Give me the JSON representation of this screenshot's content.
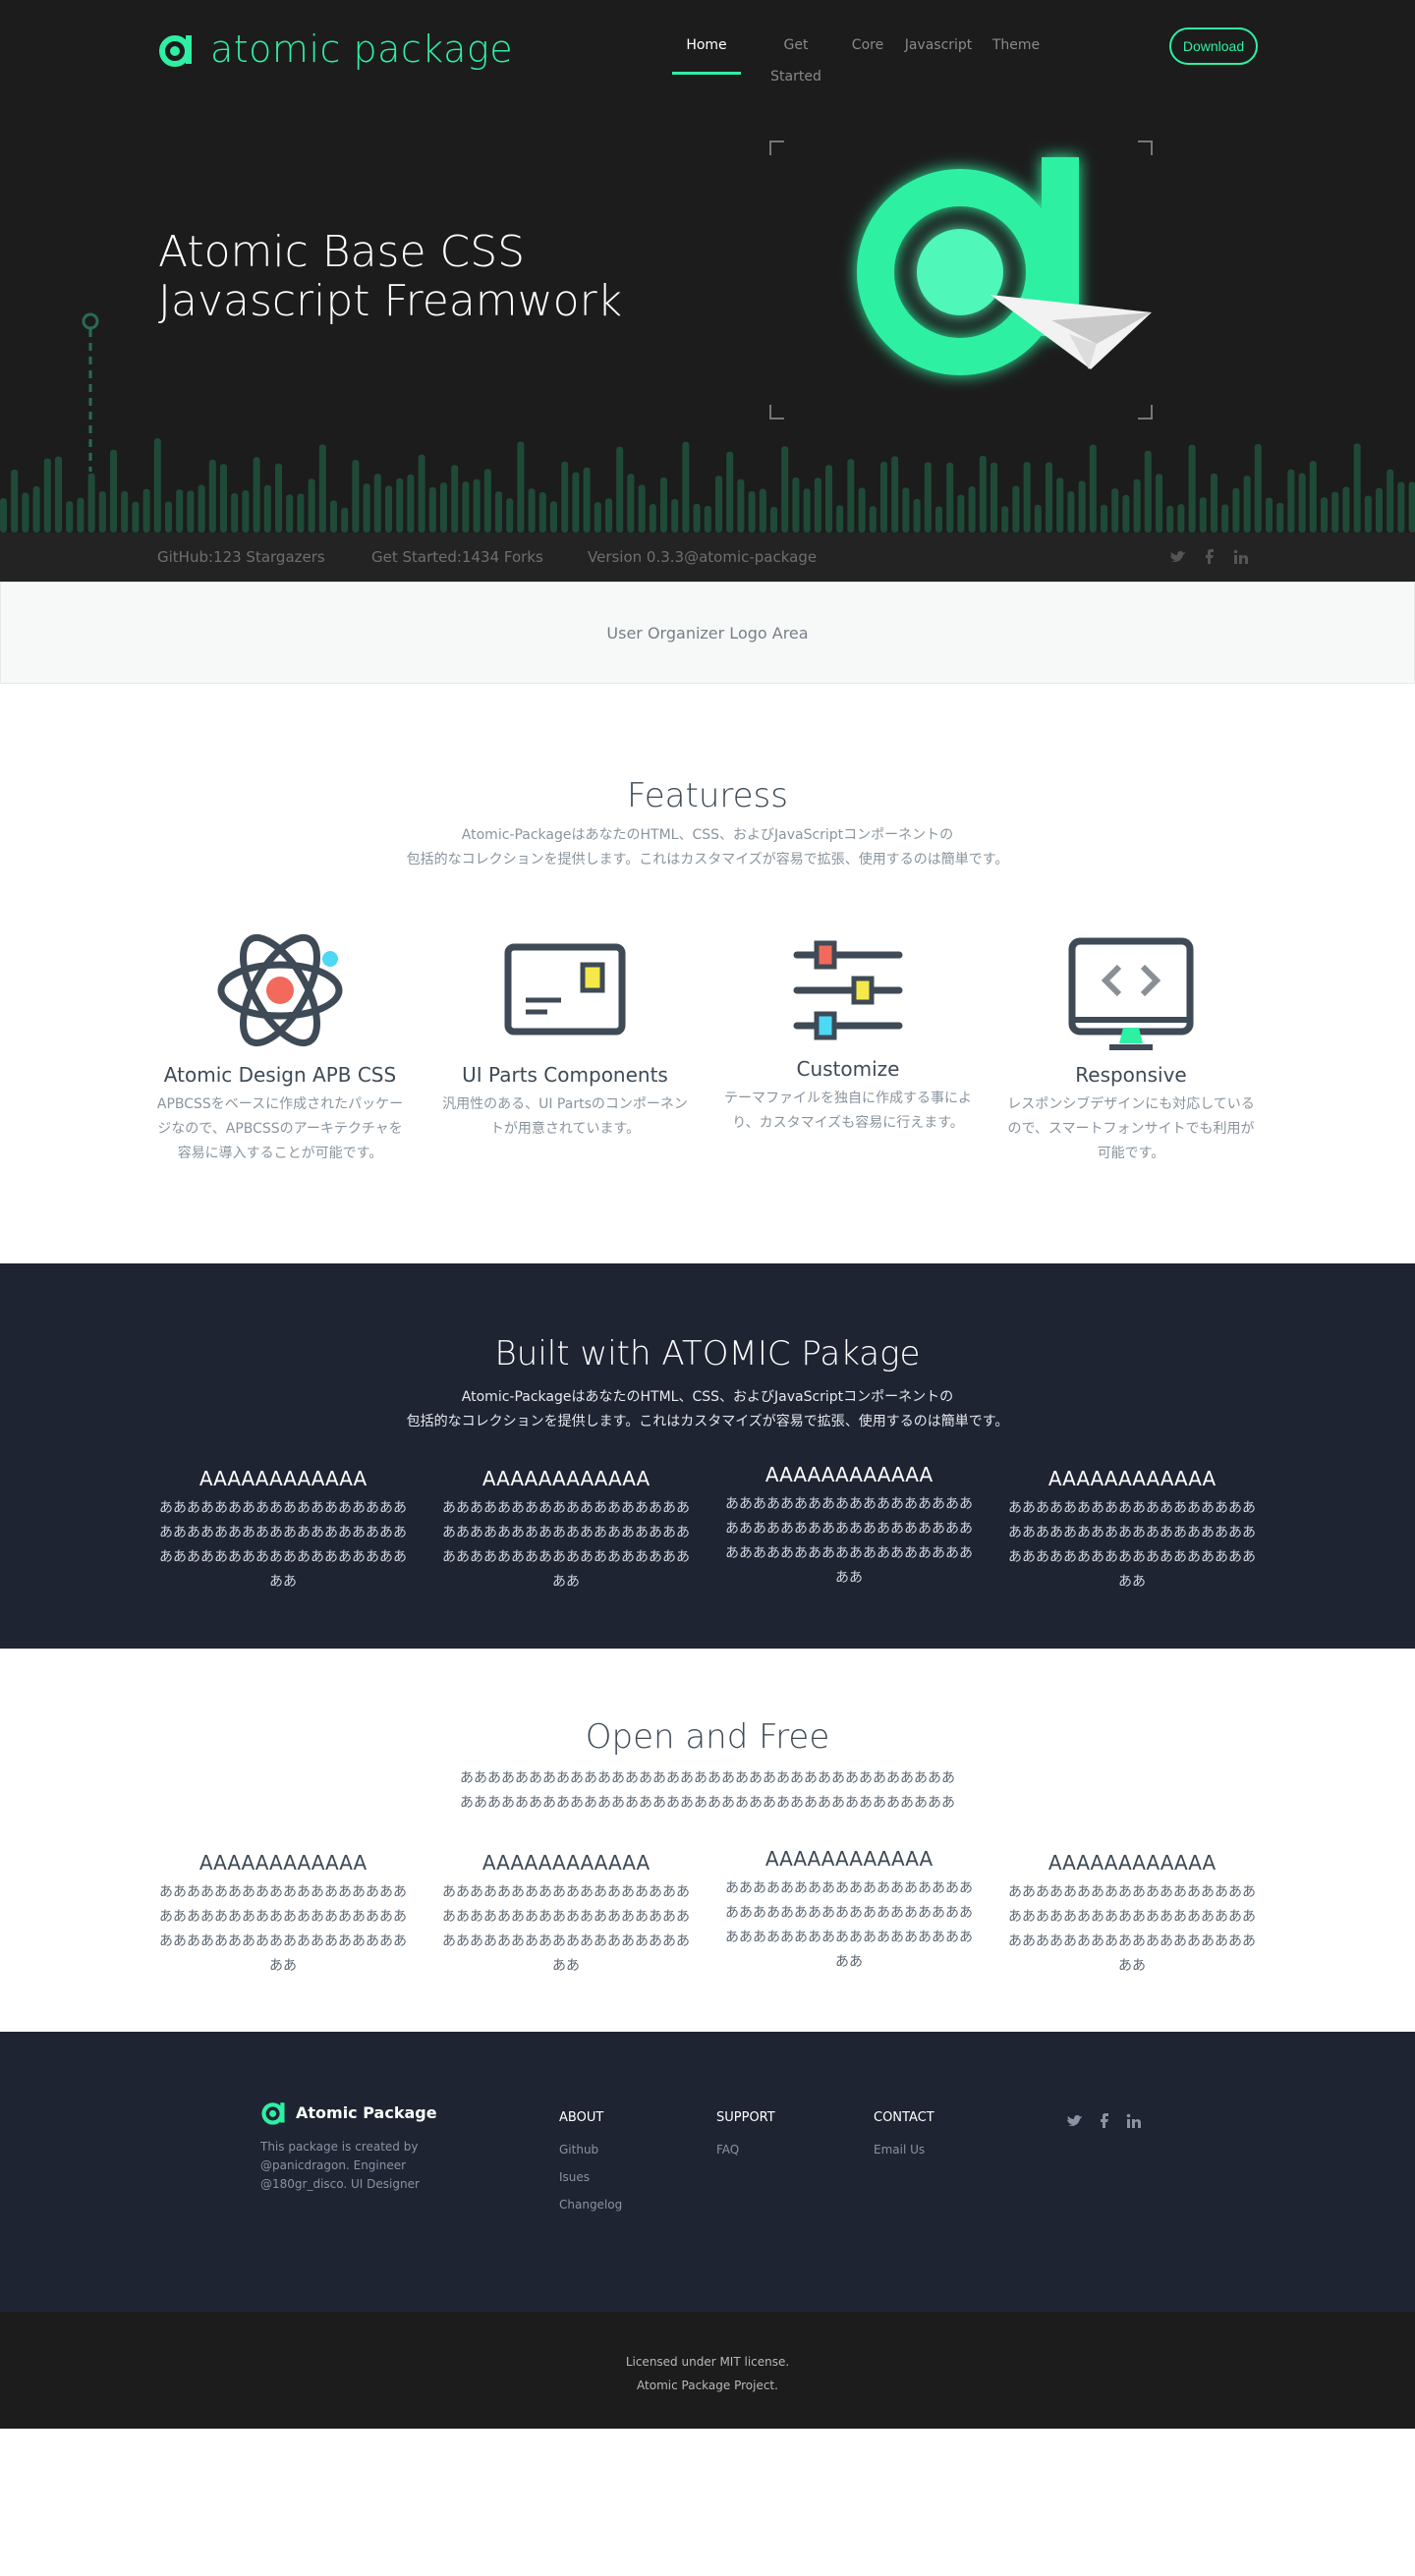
{
  "colors": {
    "accent": "#2ef0a3",
    "dark": "#1c1c1c",
    "navy": "#1f2433"
  },
  "header": {
    "brand": "atomic package",
    "nav": [
      {
        "label": "Home",
        "active": true
      },
      {
        "label": "Get Started"
      },
      {
        "label": "Core"
      },
      {
        "label": "Javascript"
      },
      {
        "label": "Theme"
      }
    ],
    "download": "Download"
  },
  "hero": {
    "title_line1": "Atomic Base CSS",
    "title_line2": "Javascript Freamwork",
    "graphic_icons": [
      "atomic-logo-icon",
      "paper-plane-icon"
    ]
  },
  "stats": {
    "github": "GitHub:123 Stargazers",
    "forks": "Get Started:1434 Forks",
    "version": "Version 0.3.3@atomic-package",
    "social_icons": [
      "twitter-icon",
      "facebook-icon",
      "linkedin-icon"
    ]
  },
  "logo_area": {
    "text": "User Organizer Logo Area"
  },
  "features": {
    "title": "Featuress",
    "desc_line1": "Atomic-PackageはあなたのHTML、CSS、およびJavaScriptコンポーネントの",
    "desc_line2": "包括的なコレクションを提供します。これはカスタマイズが容易で拡張、使用するのは簡単です。",
    "items": [
      {
        "icon": "atom-icon",
        "title": "Atomic Design APB CSS",
        "text": "APBCSSをベースに作成されたパッケージなので、APBCSSのアーキテクチャを容易に導入することが可能です。"
      },
      {
        "icon": "card-icon",
        "title": "UI Parts Components",
        "text": "汎用性のある、UI Partsのコンポーネントが用意されています。"
      },
      {
        "icon": "sliders-icon",
        "title": "Customize",
        "text": "テーマファイルを独自に作成する事により、カスタマイズも容易に行えます。"
      },
      {
        "icon": "monitor-code-icon",
        "title": "Responsive",
        "text": "レスポンシブデザインにも対応しているので、スマートフォンサイトでも利用が可能です。"
      }
    ]
  },
  "built": {
    "title": "Built with ATOMIC Pakage",
    "desc_line1": "Atomic-PackageはあなたのHTML、CSS、およびJavaScriptコンポーネントの",
    "desc_line2": "包括的なコレクションを提供します。これはカスタマイズが容易で拡張、使用するのは簡単です。",
    "items": [
      {
        "title": "AAAAAAAAAAAA",
        "text": "ああああああああああああああああああああああああああああああああああああああああああああああああああああああああ"
      },
      {
        "title": "AAAAAAAAAAAA",
        "text": "ああああああああああああああああああああああああああああああああああああああああああああああああああああああああ"
      },
      {
        "title": "AAAAAAAAAAAA",
        "text": "ああああああああああああああああああああああああああああああああああああああああああああああああああああああああ"
      },
      {
        "title": "AAAAAAAAAAAA",
        "text": "ああああああああああああああああああああああああああああああああああああああああああああああああああああああああ"
      }
    ]
  },
  "open": {
    "title": "Open and Free",
    "desc_line1": "ああああああああああああああああああああああああああああああああああああ",
    "desc_line2": "ああああああああああああああああああああああああああああああああああああ",
    "items": [
      {
        "title": "AAAAAAAAAAAA",
        "text": "ああああああああああああああああああああああああああああああああああああああああああああああああああああああああ"
      },
      {
        "title": "AAAAAAAAAAAA",
        "text": "ああああああああああああああああああああああああああああああああああああああああああああああああああああああああ"
      },
      {
        "title": "AAAAAAAAAAAA",
        "text": "ああああああああああああああああああああああああああああああああああああああああああああああああああああああああ"
      },
      {
        "title": "AAAAAAAAAAAA",
        "text": "ああああああああああああああああああああああああああああああああああああああああああああああああああああああああ"
      }
    ]
  },
  "footer": {
    "brand": "Atomic Package",
    "desc_line1": "This package is created by",
    "desc_line2": "@panicdragon. Engineer",
    "desc_line3": "@180gr_disco. UI Designer",
    "columns": [
      {
        "title": "ABOUT",
        "links": [
          "Github",
          "Isues",
          "Changelog"
        ]
      },
      {
        "title": "SUPPORT",
        "links": [
          "FAQ"
        ]
      },
      {
        "title": "CONTACT",
        "links": [
          "Email Us"
        ]
      }
    ],
    "social_icons": [
      "twitter-icon",
      "facebook-icon",
      "linkedin-icon"
    ]
  },
  "bottom": {
    "license": "Licensed under MIT license.",
    "project": "Atomic Package Project."
  }
}
